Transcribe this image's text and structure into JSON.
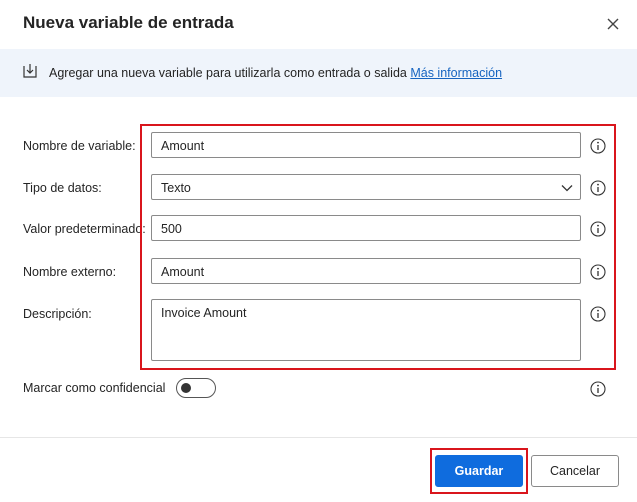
{
  "dialog": {
    "title": "Nueva variable de entrada",
    "close_icon": "close-icon"
  },
  "info": {
    "text": "Agregar una nueva variable para utilizarla como entrada o salida ",
    "link": "Más información",
    "icon": "download-icon"
  },
  "form": {
    "name": {
      "label": "Nombre de variable:",
      "value": "Amount"
    },
    "type": {
      "label": "Tipo de datos:",
      "value": "Texto"
    },
    "default": {
      "label": "Valor predeterminado:",
      "value": "500"
    },
    "external": {
      "label": "Nombre externo:",
      "value": "Amount"
    },
    "description": {
      "label": "Descripción:",
      "value": "Invoice Amount"
    },
    "sensitive": {
      "label": "Marcar como confidencial",
      "on": false
    }
  },
  "footer": {
    "save_label": "Guardar",
    "cancel_label": "Cancelar"
  },
  "colors": {
    "accent": "#0f6cde",
    "highlight": "#d9151c",
    "link": "#1664c0",
    "infobar_bg": "#eff4fb"
  }
}
